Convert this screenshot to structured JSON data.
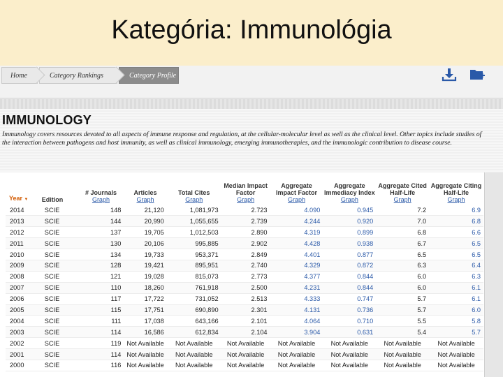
{
  "slide": {
    "title": "Kategória: Immunológia"
  },
  "breadcrumb": [
    "Home",
    "Category Rankings",
    "Category Profile"
  ],
  "icons": {
    "download": "download-icon",
    "folder": "add-folder-icon"
  },
  "category": {
    "title": "IMMUNOLOGY",
    "description": "Immunology covers resources devoted to all aspects of immune response and regulation, at the cellular-molecular level as well as the clinical level. Other topics include studies of the interaction between pathogens and host immunity, as well as clinical immunology, emerging immunotherapies, and the immunologic contribution to disease course."
  },
  "table": {
    "headers": [
      {
        "label": "Year",
        "sort": "▼"
      },
      {
        "label": "Edition"
      },
      {
        "label": "# Journals",
        "link": "Graph"
      },
      {
        "label": "Articles",
        "link": "Graph"
      },
      {
        "label": "Total Cites",
        "link": "Graph"
      },
      {
        "label": "Median Impact Factor",
        "link": "Graph"
      },
      {
        "label": "Aggregate Impact Factor",
        "link": "Graph"
      },
      {
        "label": "Aggregate Immediacy Index",
        "link": "Graph"
      },
      {
        "label": "Aggregate Cited Half-Life",
        "link": "Graph"
      },
      {
        "label": "Aggregate Citing Half-Life",
        "link": "Graph"
      }
    ],
    "rows": [
      [
        "2014",
        "SCIE",
        "148",
        "21,120",
        "1,081,973",
        "2.723",
        "4.090",
        "0.945",
        "7.2",
        "6.9"
      ],
      [
        "2013",
        "SCIE",
        "144",
        "20,990",
        "1,055,655",
        "2.739",
        "4.244",
        "0.920",
        "7.0",
        "6.8"
      ],
      [
        "2012",
        "SCIE",
        "137",
        "19,705",
        "1,012,503",
        "2.890",
        "4.319",
        "0.899",
        "6.8",
        "6.6"
      ],
      [
        "2011",
        "SCIE",
        "130",
        "20,106",
        "995,885",
        "2.902",
        "4.428",
        "0.938",
        "6.7",
        "6.5"
      ],
      [
        "2010",
        "SCIE",
        "134",
        "19,733",
        "953,371",
        "2.849",
        "4.401",
        "0.877",
        "6.5",
        "6.5"
      ],
      [
        "2009",
        "SCIE",
        "128",
        "19,421",
        "895,951",
        "2.740",
        "4.329",
        "0.872",
        "6.3",
        "6.4"
      ],
      [
        "2008",
        "SCIE",
        "121",
        "19,028",
        "815,073",
        "2.773",
        "4.377",
        "0.844",
        "6.0",
        "6.3"
      ],
      [
        "2007",
        "SCIE",
        "110",
        "18,260",
        "761,918",
        "2.500",
        "4.231",
        "0.844",
        "6.0",
        "6.1"
      ],
      [
        "2006",
        "SCIE",
        "117",
        "17,722",
        "731,052",
        "2.513",
        "4.333",
        "0.747",
        "5.7",
        "6.1"
      ],
      [
        "2005",
        "SCIE",
        "115",
        "17,751",
        "690,890",
        "2.301",
        "4.131",
        "0.736",
        "5.7",
        "6.0"
      ],
      [
        "2004",
        "SCIE",
        "111",
        "17,038",
        "643,166",
        "2.101",
        "4.064",
        "0.710",
        "5.5",
        "5.8"
      ],
      [
        "2003",
        "SCIE",
        "114",
        "16,586",
        "612,834",
        "2.104",
        "3.904",
        "0.631",
        "5.4",
        "5.7"
      ],
      [
        "2002",
        "SCIE",
        "119",
        "Not Available",
        "Not Available",
        "Not Available",
        "Not Available",
        "Not Available",
        "Not Available",
        "Not Available"
      ],
      [
        "2001",
        "SCIE",
        "114",
        "Not Available",
        "Not Available",
        "Not Available",
        "Not Available",
        "Not Available",
        "Not Available",
        "Not Available"
      ],
      [
        "2000",
        "SCIE",
        "116",
        "Not Available",
        "Not Available",
        "Not Available",
        "Not Available",
        "Not Available",
        "Not Available",
        "Not Available"
      ]
    ]
  },
  "colors": {
    "link": "#2a59a8",
    "sort": "#d25a00",
    "title_bg": "#fbeecb"
  }
}
